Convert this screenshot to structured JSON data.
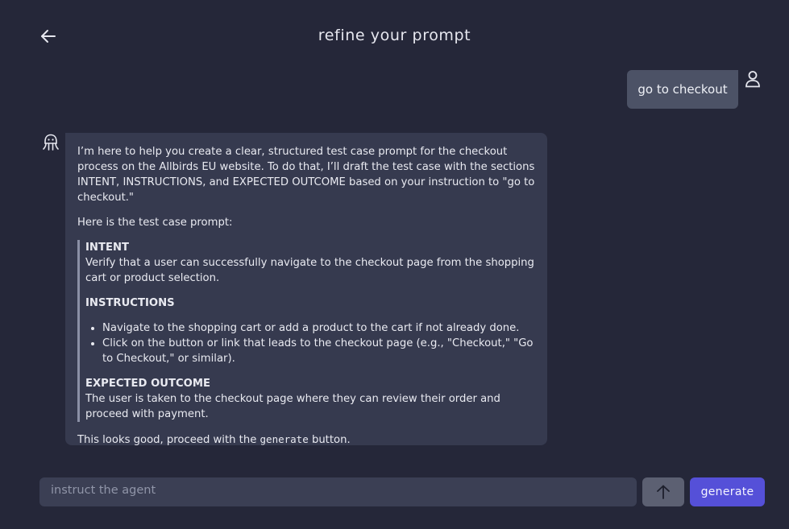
{
  "header": {
    "title": "refine your prompt"
  },
  "user_message": {
    "text": "go to checkout"
  },
  "agent_message": {
    "intro": "I’m here to help you create a clear, structured test case prompt for the checkout process on the Allbirds EU website. To do that, I’ll draft the test case with the sections INTENT, INSTRUCTIONS, and EXPECTED OUTCOME based on your instruction to \"go to checkout.\"",
    "here": "Here is the test case prompt:",
    "intent_heading": "INTENT",
    "intent_text": "Verify that a user can successfully navigate to the checkout page from the shopping cart or product selection.",
    "instructions_heading": "INSTRUCTIONS",
    "instructions": [
      "Navigate to the shopping cart or add a product to the cart if not already done.",
      "Click on the button or link that leads to the checkout page (e.g., \"Checkout,\" \"Go to Checkout,\" or similar)."
    ],
    "outcome_heading": "EXPECTED OUTCOME",
    "outcome_text": "The user is taken to the checkout page where they can review their order and proceed with payment.",
    "closing_before": "This looks good, proceed with the ",
    "closing_code": "generate",
    "closing_after": " button."
  },
  "composer": {
    "placeholder": "instruct the agent",
    "generate_label": "generate"
  },
  "icons": {
    "back": "arrow-left-icon",
    "user": "user-icon",
    "agent": "octopus-icon",
    "send": "arrow-up-icon"
  }
}
